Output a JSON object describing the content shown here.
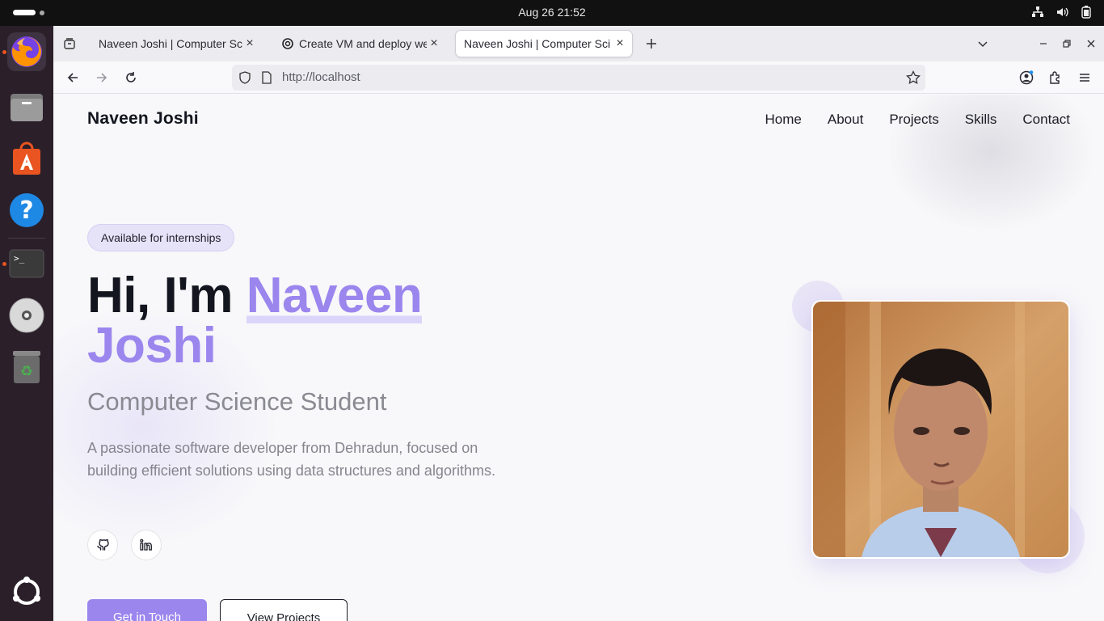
{
  "system": {
    "clock": "Aug 26  21:52"
  },
  "dock": {
    "apps": [
      "firefox",
      "files",
      "app-center",
      "help",
      "terminal",
      "disc",
      "trash",
      "show-apps"
    ]
  },
  "browser": {
    "tabs": [
      {
        "title": "Naveen Joshi | Computer Sci",
        "active": false
      },
      {
        "title": "Create VM and deploy we",
        "active": false
      },
      {
        "title": "Naveen Joshi | Computer Sci",
        "active": true
      }
    ],
    "url": "http://localhost"
  },
  "page": {
    "brand": "Naveen Joshi",
    "nav": [
      "Home",
      "About",
      "Projects",
      "Skills",
      "Contact"
    ],
    "badge": "Available for internships",
    "hero": {
      "greeting": "Hi, I'm ",
      "name_first": "Naveen",
      "name_last": "Joshi"
    },
    "subtitle": "Computer Science Student",
    "description": "A passionate software developer from Dehradun, focused on building efficient solutions using data structures and algorithms.",
    "social": [
      "github-icon",
      "linkedin-icon"
    ],
    "buttons": {
      "primary": "Get in Touch",
      "secondary": "View Projects"
    },
    "colors": {
      "accent": "#9b86ee"
    }
  }
}
